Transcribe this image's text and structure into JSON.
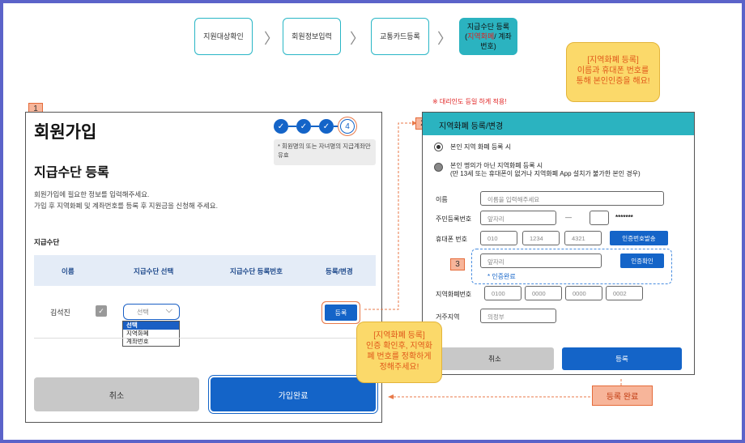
{
  "steps": [
    {
      "label": "지원대상확인"
    },
    {
      "label": "회원정보입력"
    },
    {
      "label": "교통카드등록"
    },
    {
      "line1": "지급수단 등록",
      "line2_open": "(",
      "line2_red": "지역화폐",
      "line2_rest": "/ 계좌",
      "line3": "번호)"
    }
  ],
  "left": {
    "badge": "1",
    "title": "회원가입",
    "progress": [
      "✓",
      "✓",
      "✓",
      "4"
    ],
    "note": "* 회원명의 또는 자녀명의 지급계좌만 유효",
    "subtitle": "지급수단 등록",
    "desc1": "회원가입에 필요한 정보를 입력해주세요.",
    "desc2": "가입 후 지역화폐 및 계좌번호를 등록 후 지원금을 신청해 주세요.",
    "section": "지급수단",
    "headers": [
      "이름",
      "지급수단 선택",
      "지급수단 등록번호",
      "등록/변경"
    ],
    "row": {
      "name": "김석진",
      "check": "✓",
      "select_value": "선택",
      "register_btn": "등록"
    },
    "dropdown": [
      "선택",
      "지역화폐",
      "계좌번호"
    ],
    "cancel": "취소",
    "submit": "가입완료"
  },
  "right": {
    "badge": "2",
    "header": "지역화폐 등록/변경",
    "warn": "※ 대리인도 등일 하게 적용!",
    "radio1": "본인 지역 화폐 등록 시",
    "radio2_l1": "본인 명의가 아닌 지역화폐 등록 시",
    "radio2_l2": "(만 13세 또는 휴대폰이 없거나 지역화폐 App 설치가 불가한 본인 경우)",
    "name_label": "이름",
    "name_placeholder": "이름을 입력해주세요",
    "rrn_label": "주민등록번호",
    "rrn_front": "앞자리",
    "rrn_dash": "—",
    "rrn_mask": "*******",
    "phone_label": "휴대폰 번호",
    "phone": [
      "010",
      "1234",
      "4321"
    ],
    "send_btn": "인증번호발송",
    "badge3": "3",
    "code_placeholder": "앞자리",
    "verify_btn": "인증확인",
    "verified": "* 인증완료",
    "card_label": "지역화폐번호",
    "card": [
      "0100",
      "0000",
      "0000",
      "0002"
    ],
    "region_label": "거주지역",
    "region": "의정부",
    "cancel": "취소",
    "register": "등록"
  },
  "callouts": {
    "top_l1": "[지역화폐 등록]",
    "top_l2": "이름과 휴대폰 번호를",
    "top_l3": "통해 본인인증을 해요!",
    "mid_l1": "[지역화폐 등록]",
    "mid_l2": "인증 확인후, 지역화",
    "mid_l3": "폐 번호를 정확하게",
    "mid_l4": "정해주세요!",
    "done": "등록 완료"
  }
}
